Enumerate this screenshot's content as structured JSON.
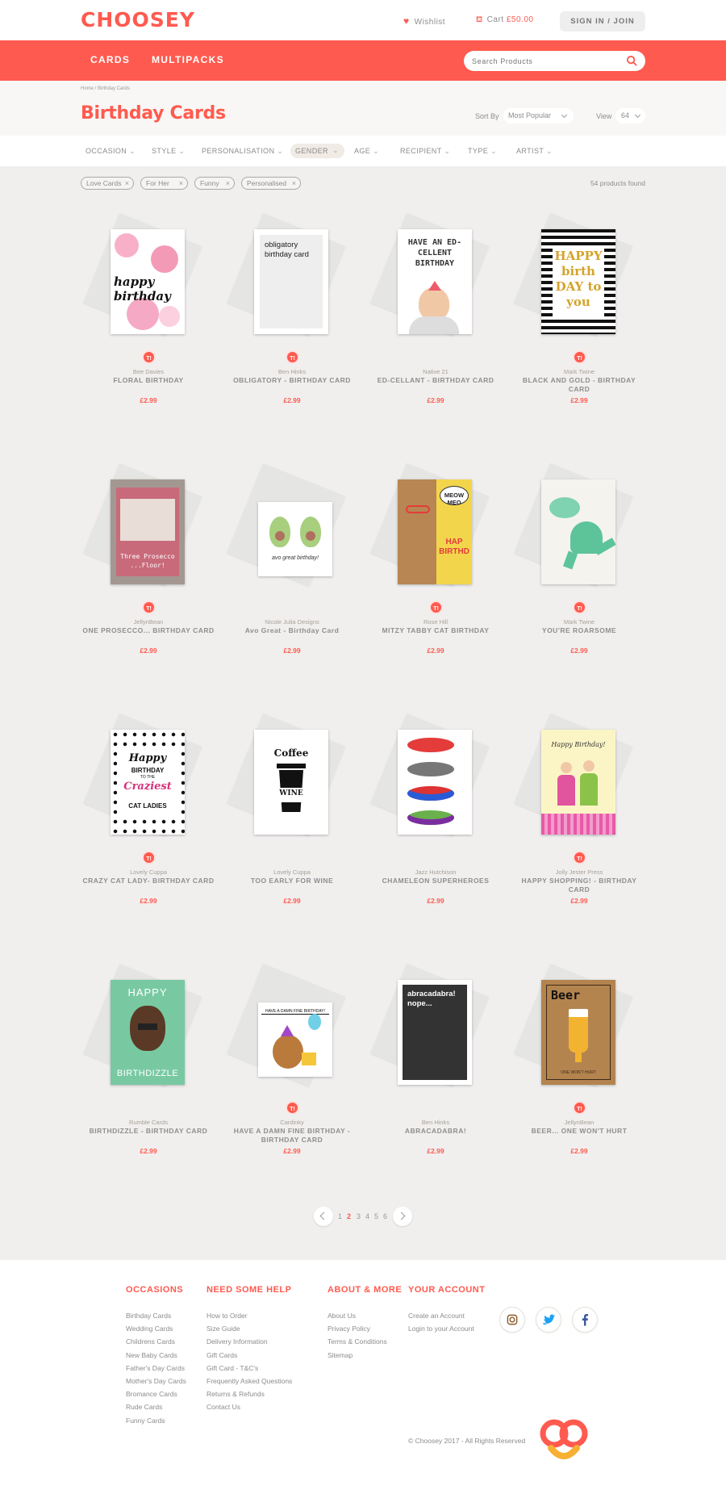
{
  "header": {
    "logo": "CHOOSEY",
    "wishlist": "Wishlist",
    "cart_label": "Cart",
    "cart_amount": "£50.00",
    "signin": "SIGN IN / JOIN"
  },
  "nav": {
    "items": [
      "CARDS",
      "MULTIPACKS"
    ],
    "search_placeholder": "Search Products"
  },
  "page": {
    "breadcrumb": "Home / Birthday Cards",
    "title": "Birthday Cards",
    "sort_label": "Sort By",
    "sort_value": "Most Popular",
    "view_label": "View",
    "view_value": "64"
  },
  "filters": [
    "OCCASION",
    "STYLE",
    "PERSONALISATION",
    "GENDER",
    "AGE",
    "RECIPIENT",
    "TYPE",
    "ARTIST"
  ],
  "active_filter": "GENDER",
  "tags": [
    "Love Cards",
    "For Her",
    "Funny",
    "Personalised"
  ],
  "products_found": "54 products found",
  "products": [
    {
      "seller": "Bee Davies",
      "name": "FLORAL BIRTHDAY",
      "price": "£2.99",
      "badge": true
    },
    {
      "seller": "Ben Hinks",
      "name": "OBLIGATORY - BIRTHDAY CARD",
      "price": "£2.99",
      "badge": true
    },
    {
      "seller": "Native 21",
      "name": "ED-CELLANT - BIRTHDAY CARD",
      "price": "£2.99",
      "badge": false
    },
    {
      "seller": "Mark Twine",
      "name": "BLACK AND GOLD - BIRTHDAY CARD",
      "price": "£2.99",
      "badge": true
    },
    {
      "seller": "JellynBean",
      "name": "ONE PROSECCO... BIRTHDAY CARD",
      "price": "£2.99",
      "badge": true
    },
    {
      "seller": "Nicole Julia Designs",
      "name": "Avo Great - Birthday Card",
      "price": "£2.99",
      "badge": false
    },
    {
      "seller": "Rose Hill",
      "name": "MITZY TABBY CAT BIRTHDAY",
      "price": "£2.99",
      "badge": true
    },
    {
      "seller": "Mark Twine",
      "name": "YOU'RE ROARSOME",
      "price": "£2.99",
      "badge": true
    },
    {
      "seller": "Lovely Cuppa",
      "name": "CRAZY CAT LADY- BIRTHDAY CARD",
      "price": "£2.99",
      "badge": true
    },
    {
      "seller": "Lovely Cuppa",
      "name": "TOO EARLY FOR WINE",
      "price": "£2.99",
      "badge": false
    },
    {
      "seller": "Jazz Hutchison",
      "name": "CHAMELEON SUPERHEROES",
      "price": "£2.99",
      "badge": false
    },
    {
      "seller": "Jolly Jester Press",
      "name": "HAPPY SHOPPING! - BIRTHDAY CARD",
      "price": "£2.99",
      "badge": true
    },
    {
      "seller": "Rumble Cards",
      "name": "BIRTHDIZZLE - BIRTHDAY CARD",
      "price": "£2.99",
      "badge": false
    },
    {
      "seller": "Cardinky",
      "name": "HAVE A DAMN FINE BIRTHDAY - BIRTHDAY CARD",
      "price": "£2.99",
      "badge": true
    },
    {
      "seller": "Ben Hinks",
      "name": "ABRACADABRA!",
      "price": "£2.99",
      "badge": false
    },
    {
      "seller": "JellynBean",
      "name": "BEER... ONE WON'T HURT",
      "price": "£2.99",
      "badge": true
    }
  ],
  "card_text": {
    "obligatory": "obligatory birthday card",
    "ed": "HAVE AN ED-CELLENT BIRTHDAY",
    "bag": "HAPPY birth DAY to you",
    "prosecco": "Three Prosecco ...Floor!",
    "avo": "avo great birthday!",
    "meow": "MEOW MEO",
    "hap": "HAP BIRTHD",
    "crazy1": "Happy",
    "crazy2": "BIRTHDAY",
    "crazy3": "TO THE",
    "crazy4": "Craziest",
    "crazy5": "CAT LADIES",
    "coffee": "Coffee",
    "wine": "WINE",
    "shopping": "Happy Birthday!",
    "happy": "HAPPY",
    "birthdizzle": "BIRTHDIZZLE",
    "damn": "HAVE A DAMN FINE BIRTHDAY!",
    "abra": "abracadabra! nope...",
    "beer": "Beer",
    "beer_sub": "ONE WON'T HURT"
  },
  "pagination": {
    "pages": [
      "1",
      "2",
      "3",
      "4",
      "5",
      "6"
    ],
    "current": "2"
  },
  "footer": {
    "occasions_title": "OCCASIONS",
    "occasions": [
      "Birthday Cards",
      "Wedding Cards",
      "Childrens Cards",
      "New Baby Cards",
      "Father's Day Cards",
      "Mother's Day Cards",
      "Bromance Cards",
      "Rude Cards",
      "Funny Cards"
    ],
    "help_title": "NEED SOME HELP",
    "help": [
      "How to Order",
      "Size Guide",
      "Delivery Information",
      "Gift Cards",
      "Gift Card - T&C's",
      "Frequently Asked Questions",
      "Returns & Refunds",
      "Contact Us"
    ],
    "about_title": "ABOUT & MORE",
    "about": [
      "About Us",
      "Privacy Policy",
      "Terms & Conditions",
      "Sitemap"
    ],
    "account_title": "YOUR ACCOUNT",
    "account": [
      "Create an Account",
      "Login to your Account"
    ],
    "copyright": "© Choosey 2017 - All Rights Reserved"
  },
  "colors": {
    "brand": "#ff5a4f",
    "background": "#f0efee"
  }
}
